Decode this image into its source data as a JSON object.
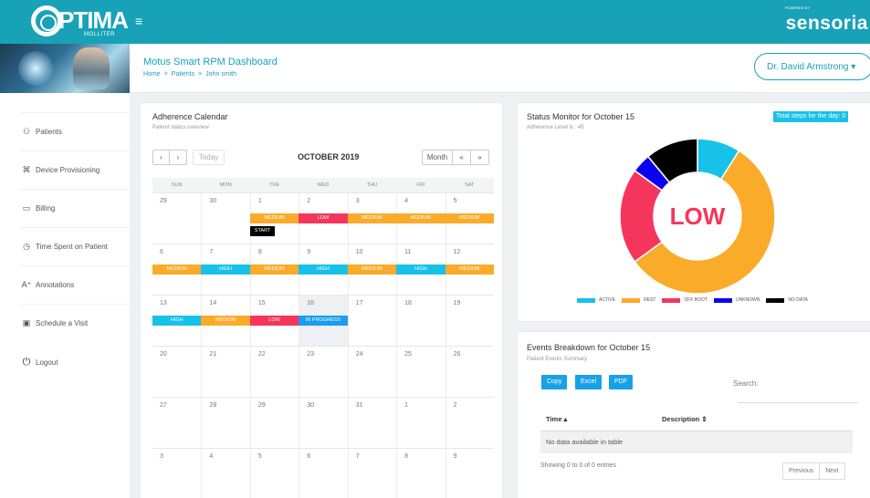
{
  "topbar": {
    "logo_text": "PTIMA",
    "logo_sub": "MOLLITER",
    "brand_tiny": "POWERED BY",
    "brand": "sensoria",
    "menu_glyph": "≡"
  },
  "header": {
    "title": "Motus Smart RPM Dashboard",
    "breadcrumb": [
      "Home",
      ">",
      "Patients",
      ">",
      "John smith"
    ],
    "user": "Dr. David Armstrong ▾"
  },
  "sidebar": {
    "items": [
      {
        "icon": "patients-icon",
        "glyph": "⚇",
        "label": "Patients"
      },
      {
        "icon": "device-icon",
        "glyph": "⌘",
        "label": "Device Provisioning"
      },
      {
        "icon": "billing-icon",
        "glyph": "▭",
        "label": "Billing"
      },
      {
        "icon": "clock-icon",
        "glyph": "◷",
        "label": "Time Spent on Patient"
      },
      {
        "icon": "annotation-icon",
        "glyph": "A⁺",
        "label": "Annotations"
      },
      {
        "icon": "calendar-icon",
        "glyph": "▣",
        "label": "Schedule a Visit"
      },
      {
        "icon": "power-icon",
        "glyph": "⏻",
        "label": "Logout"
      }
    ]
  },
  "calendar": {
    "title": "Adherence Calendar",
    "subtitle": "Patient status overview",
    "prev": "‹",
    "next": "›",
    "today": "Today",
    "month": "OCTOBER 2019",
    "view_month": "Month",
    "nav_prev": "«",
    "nav_next": "»",
    "dows": [
      "SUN",
      "MON",
      "TUE",
      "WED",
      "THU",
      "FRI",
      "SAT"
    ],
    "weeks": [
      {
        "days": [
          "29",
          "30",
          "1",
          "2",
          "3",
          "4",
          "5"
        ],
        "events": [
          null,
          null,
          "MEDIUM",
          "LOW",
          "MEDIUM",
          "MEDIUM",
          "MEDIUM"
        ],
        "extra": [
          null,
          null,
          "START",
          null,
          null,
          null,
          null
        ]
      },
      {
        "days": [
          "6",
          "7",
          "8",
          "9",
          "10",
          "11",
          "12"
        ],
        "events": [
          "MEDIUM",
          "HIGH",
          "MEDIUM",
          "HIGH",
          "MEDIUM",
          "HIGH",
          "MEDIUM"
        ]
      },
      {
        "days": [
          "13",
          "14",
          "15",
          "16",
          "17",
          "18",
          "19"
        ],
        "events": [
          "HIGH",
          "MEDIUM",
          "LOW",
          "IN PROGRESS",
          null,
          null,
          null
        ]
      },
      {
        "days": [
          "20",
          "21",
          "22",
          "23",
          "24",
          "25",
          "26"
        ],
        "events": []
      },
      {
        "days": [
          "27",
          "28",
          "29",
          "30",
          "31",
          "1",
          "2"
        ],
        "events": []
      },
      {
        "days": [
          "3",
          "4",
          "5",
          "6",
          "7",
          "8",
          "9"
        ],
        "events": []
      }
    ],
    "colors": {
      "MEDIUM": "#fbab2a",
      "LOW": "#f5365c",
      "HIGH": "#17c1e8",
      "IN PROGRESS": "#1b9cf0",
      "START": "#000000"
    }
  },
  "status": {
    "title": "Status Monitor for October 15",
    "subtitle": "Adherence Level is : 45",
    "badge": "Total steps for the day: 0",
    "center_label": "LOW",
    "center_color": "#f5365c",
    "slices": [
      {
        "name": "ACTIVE",
        "value": 9,
        "color": "#17c1e8"
      },
      {
        "name": "REST",
        "value": 56,
        "color": "#fbab2a"
      },
      {
        "name": "OFF BOOT",
        "value": 20,
        "color": "#f5365c"
      },
      {
        "name": "UNKNOWN",
        "value": 4,
        "color": "#0d00ee"
      },
      {
        "name": "NO DATA",
        "value": 11,
        "color": "#000000"
      }
    ]
  },
  "events": {
    "title": "Events Breakdown for October 15",
    "subtitle": "Patient Events Summary",
    "buttons": [
      "Copy",
      "Excel",
      "PDF"
    ],
    "search_label": "Search:",
    "col_time": "Time ▴",
    "col_desc": "Description ⇕",
    "empty": "No data available in table",
    "showing": "Showing 0 to 0 of 0 entries",
    "previous": "Previous",
    "next": "Next"
  }
}
